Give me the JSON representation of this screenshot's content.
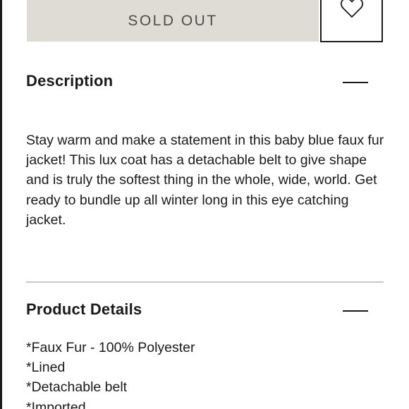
{
  "purchase": {
    "sold_out_label": "SOLD OUT",
    "wishlist_icon": "heart-icon"
  },
  "description": {
    "title": "Description",
    "text": "Stay warm and make a statement in this baby blue faux fur jacket! This lux coat has a detachable belt to give shape and is truly the softest thing in the whole, wide, world. Get ready to bundle up all winter long in this eye catching jacket.",
    "toggle_icon": "minus-icon"
  },
  "product_details": {
    "title": "Product Details",
    "toggle_icon": "minus-icon",
    "items": [
      "*Faux Fur - 100% Polyester",
      "*Lined",
      "*Detachable belt",
      "*Imported"
    ]
  },
  "colors": {
    "sold_out_bg": "#dedcd4",
    "text": "#1a1a1a",
    "divider": "#c9c9c9"
  }
}
